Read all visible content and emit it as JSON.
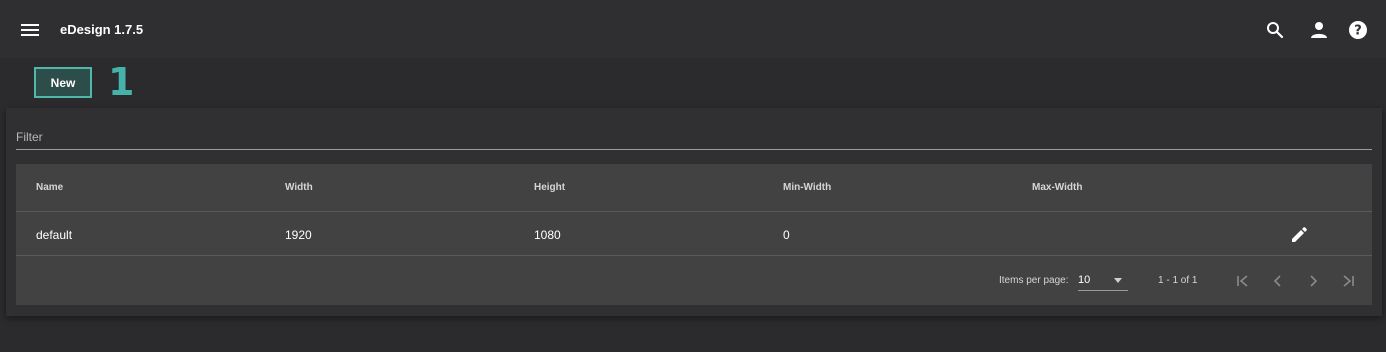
{
  "app": {
    "title": "eDesign 1.7.5"
  },
  "toolbar": {
    "menu_icon": "menu-icon",
    "search_icon": "search-icon",
    "account_icon": "person-icon",
    "help_icon": "help-icon"
  },
  "actions": {
    "new_label": "New",
    "annotation_number": "1"
  },
  "filter": {
    "placeholder": "Filter",
    "value": ""
  },
  "table": {
    "columns": [
      "Name",
      "Width",
      "Height",
      "Min-Width",
      "Max-Width"
    ],
    "rows": [
      {
        "name": "default",
        "width": "1920",
        "height": "1080",
        "min_width": "0",
        "max_width": ""
      }
    ],
    "row_action_icon": "edit-pencil-icon"
  },
  "paginator": {
    "items_per_page_label": "Items per page:",
    "items_per_page_value": "10",
    "range_label": "1 - 1 of 1"
  },
  "colors": {
    "accent": "#45b3aa",
    "background": "#2b2b2d",
    "table_bg": "#424242"
  }
}
